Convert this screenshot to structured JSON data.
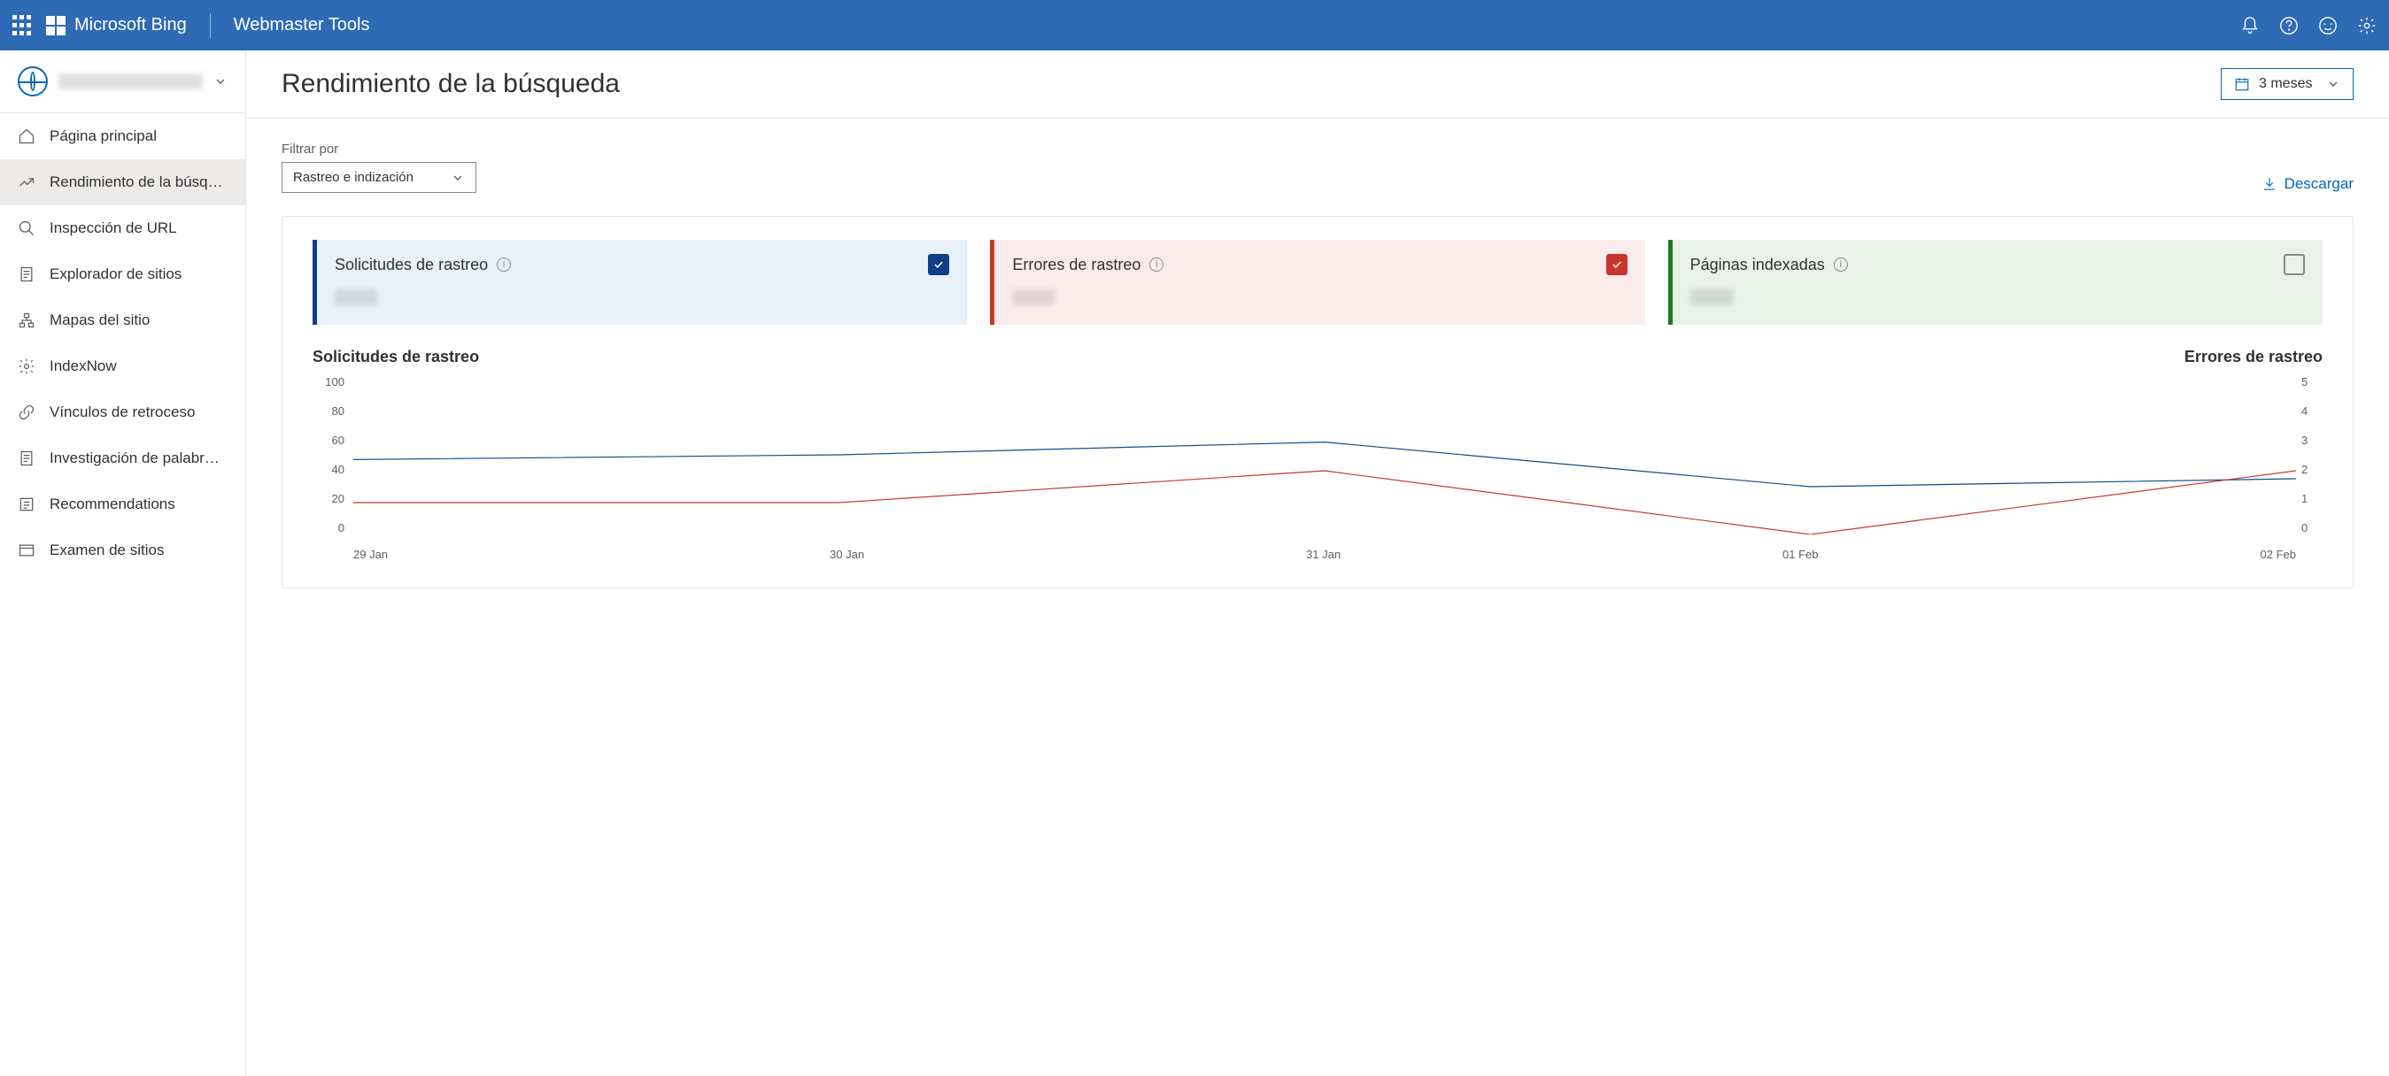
{
  "header": {
    "brand": "Microsoft Bing",
    "subtitle": "Webmaster Tools"
  },
  "sidebar": {
    "items": [
      {
        "label": "Página principal"
      },
      {
        "label": "Rendimiento de la búsque..."
      },
      {
        "label": "Inspección de URL"
      },
      {
        "label": "Explorador de sitios"
      },
      {
        "label": "Mapas del sitio"
      },
      {
        "label": "IndexNow"
      },
      {
        "label": "Vínculos de retroceso"
      },
      {
        "label": "Investigación de palabras ..."
      },
      {
        "label": "Recommendations"
      },
      {
        "label": "Examen de sitios"
      }
    ]
  },
  "page": {
    "title": "Rendimiento de la búsqueda",
    "range_label": "3 meses",
    "filter_label": "Filtrar por",
    "filter_value": "Rastreo e indización",
    "download_label": "Descargar"
  },
  "cards": [
    {
      "title": "Solicitudes de rastreo",
      "checked": true,
      "color": "blue"
    },
    {
      "title": "Errores de rastreo",
      "checked": true,
      "color": "red"
    },
    {
      "title": "Páginas indexadas",
      "checked": false,
      "color": "green"
    }
  ],
  "chart_data": {
    "type": "line",
    "x": [
      "29 Jan",
      "30 Jan",
      "31 Jan",
      "01 Feb",
      "02 Feb"
    ],
    "series": [
      {
        "name": "Solicitudes de rastreo",
        "values": [
          47,
          50,
          58,
          30,
          35
        ],
        "axis": "left",
        "color": "#0f4c8b"
      },
      {
        "name": "Errores de rastreo",
        "values": [
          1,
          1,
          2,
          0,
          2
        ],
        "axis": "right",
        "color": "#c8362b"
      }
    ],
    "y_left": {
      "label": "Solicitudes de rastreo",
      "ticks": [
        100,
        80,
        60,
        40,
        20,
        0
      ]
    },
    "y_right": {
      "label": "Errores de rastreo",
      "ticks": [
        5,
        4,
        3,
        2,
        1,
        0
      ]
    }
  }
}
